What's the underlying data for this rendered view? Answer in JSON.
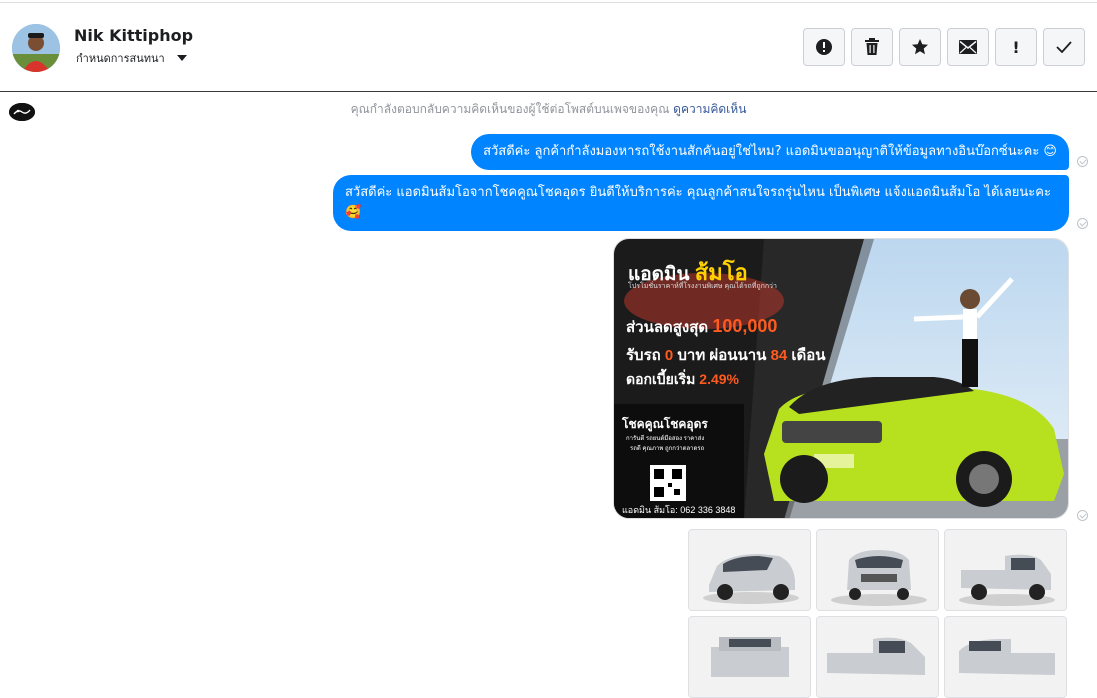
{
  "header": {
    "contact_name": "Nik Kittiphop",
    "assign_label": "กำหนดการสนทนา",
    "actions": [
      {
        "name": "report-spam-button",
        "icon": "alert-circle-icon"
      },
      {
        "name": "delete-button",
        "icon": "trash-icon"
      },
      {
        "name": "star-button",
        "icon": "star-icon"
      },
      {
        "name": "mark-unread-button",
        "icon": "envelope-icon"
      },
      {
        "name": "follow-up-button",
        "icon": "exclamation-icon",
        "glyph": "!"
      },
      {
        "name": "mark-done-button",
        "icon": "check-icon"
      }
    ]
  },
  "context": {
    "text": "คุณกำลังตอบกลับความคิดเห็นของผู้ใช้ต่อโพสต์บนเพจของคุณ",
    "link": "ดูความคิดเห็น"
  },
  "messages": [
    {
      "text": "สวัสดีค่ะ ลูกค้ากำลังมองหารถใช้งานสักคันอยู่ใช่ไหม? แอดมินขออนุญาติให้ข้อมูลทางอินบ๊อกซ์นะคะ 😊"
    },
    {
      "text": "สวัสดีค่ะ แอดมินส้มโอจากโชคคูณโชคอุดร ยินดีให้บริการค่ะ   คุณลูกค้าสนใจรถรุ่นไหน เป็นพิเศษ แจ้งแอดมินส้มโอ ได้เลยนะคะ🥰"
    }
  ],
  "promo": {
    "title_1": "แอดมิน",
    "title_2": "ส้มโอ",
    "tagline": "โปรโมชั่นราคาห์ที่โรงงานพิเศษ คุณได้รถที่ถูกกว่า",
    "discount_label": "ส่วนลดสูงสุด",
    "discount_value": "100,000",
    "line2_a": "รับรถ",
    "line2_zero": "0",
    "line2_b": "บาท ผ่อนนาน",
    "line2_months": "84",
    "line2_c": "เดือน",
    "line3_label": "ดอกเบี้ยเริ่ม",
    "line3_rate": "2.49%",
    "dealer": "โชคคูณโชคอุดร",
    "dealer_sub1": "การันตี รถยนต์มือสอง ราคาส่ง",
    "dealer_sub2": "รถดี คุณภาพ ถูกกว่าตลาดรถ",
    "contact": "แอดมิน ส้มโอ: 062 336 3848"
  },
  "colors": {
    "bubble": "#0084ff",
    "promo_accent": "#ff5a1f",
    "car_green": "#b7e01e"
  }
}
